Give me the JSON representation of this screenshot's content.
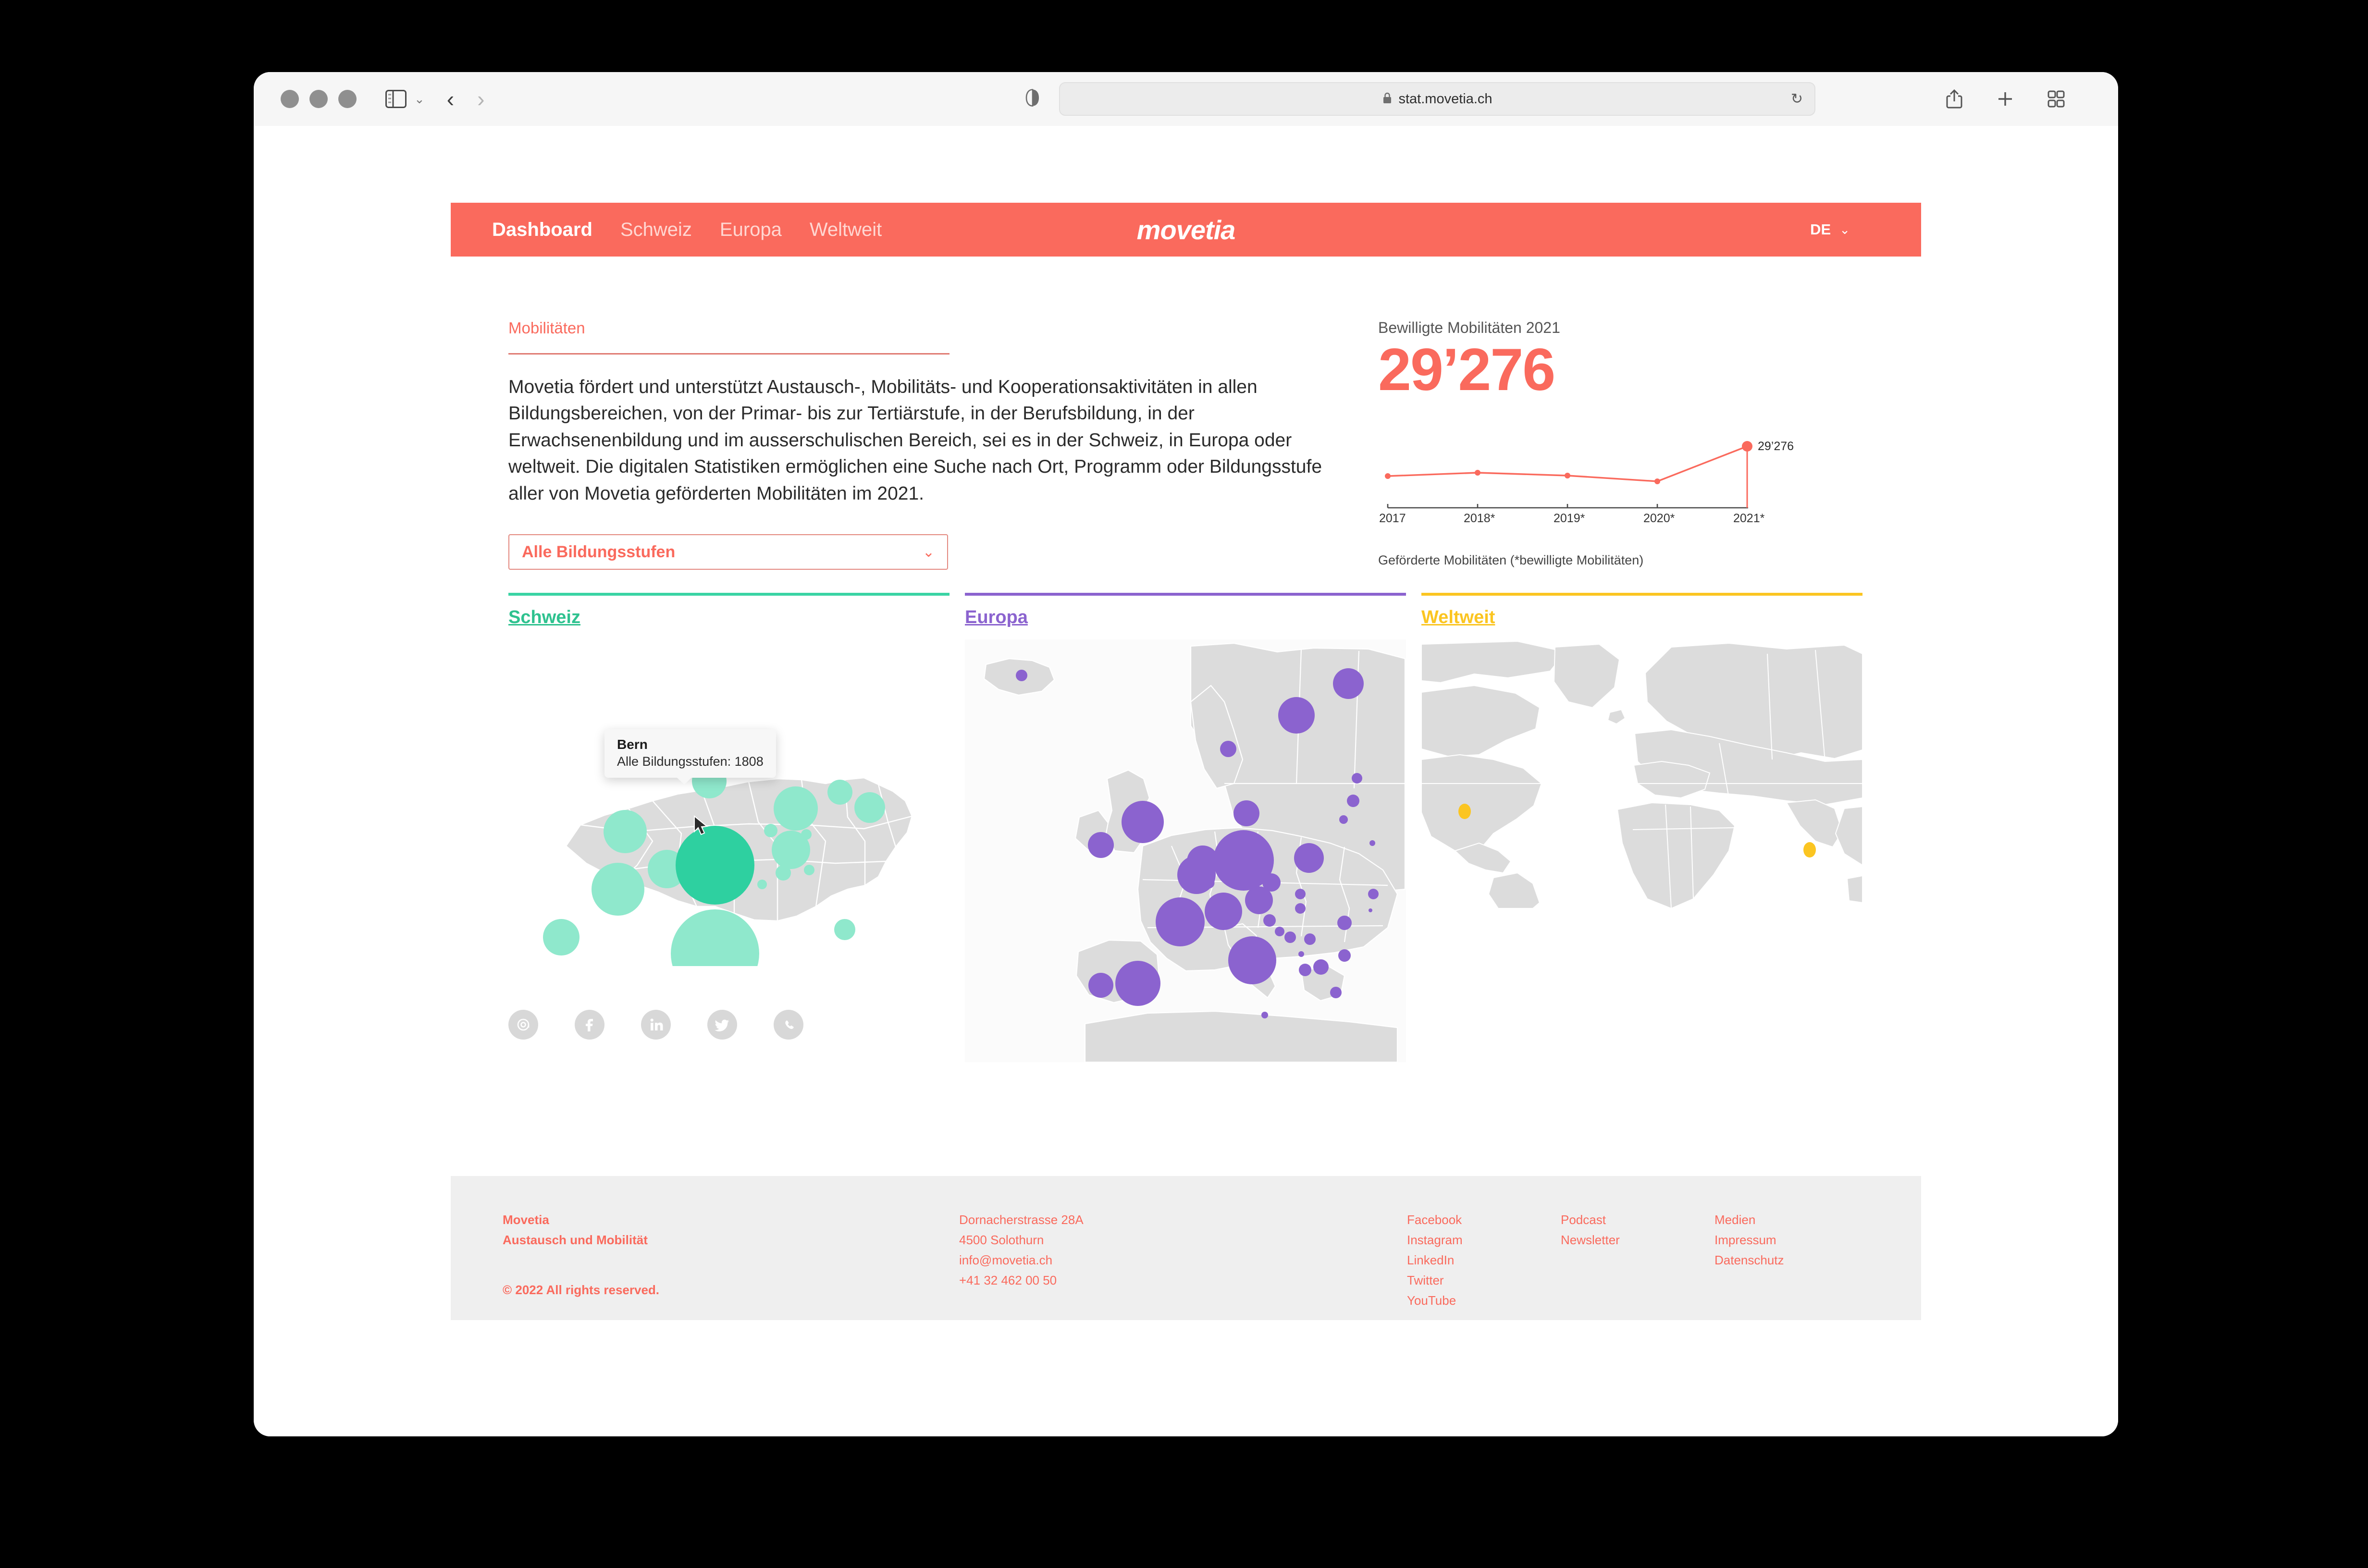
{
  "browser": {
    "url": "stat.movetia.ch",
    "lock_icon": "lock-icon",
    "reload_icon": "reload-icon",
    "back_icon": "chevron-left-icon",
    "forward_icon": "chevron-right-icon",
    "sidebar_icon": "sidebar-toggle-icon",
    "reader_icon": "reader-view-icon",
    "share_icon": "share-icon",
    "newtab_icon": "plus-icon",
    "tabs_icon": "tab-overview-icon"
  },
  "header": {
    "nav": [
      {
        "label": "Dashboard",
        "active": true
      },
      {
        "label": "Schweiz",
        "active": false
      },
      {
        "label": "Europa",
        "active": false
      },
      {
        "label": "Weltweit",
        "active": false
      }
    ],
    "brand": "movetia",
    "language": "DE",
    "chevron": "⌄",
    "bg_color": "#fa6a5d"
  },
  "intro": {
    "title": "Mobilitäten",
    "body": "Movetia fördert und unterstützt Austausch-, Mobilitäts- und Kooperationsaktivitäten in allen Bildungsbereichen, von der Primar- bis zur Tertiärstufe, in der Berufsbildung, in der Erwachsenenbildung und im ausserschulischen Bereich, sei es in der Schweiz, in Europa oder weltweit. Die digitalen Statistiken ermöglichen eine Suche nach Ort, Programm oder Bildungsstufe aller von Movetia geförderten Mobilitäten im 2021."
  },
  "stat": {
    "label": "Bewilligte Mobilitäten 2021",
    "value": "29’276",
    "caption": "Geförderte Mobilitäten (*bewilligte Mobilitäten)",
    "point_label": "29’276",
    "accent": "#fa6a5d"
  },
  "chart_data": {
    "type": "line",
    "title": "Bewilligte Mobilitäten 2021",
    "xlabel": "",
    "ylabel": "",
    "categories": [
      "2017",
      "2018*",
      "2019*",
      "2020*",
      "2021*"
    ],
    "values": [
      20500,
      21600,
      20900,
      19200,
      29276
    ],
    "ylim": [
      0,
      32000
    ],
    "grid": false,
    "legend": "none",
    "annotations": [
      "29’276"
    ],
    "series_color": "#fa6a5d",
    "caption": "Geförderte Mobilitäten (*bewilligte Mobilitäten)"
  },
  "filter": {
    "value": "Alle Bildungsstufen",
    "chevron": "⌄"
  },
  "panels": [
    {
      "key": "schweiz",
      "title": "Schweiz",
      "color": "#2ec28f",
      "rule_color": "#3ad4a4"
    },
    {
      "key": "europa",
      "title": "Europa",
      "color": "#8b63cf",
      "rule_color": "#8b63cf"
    },
    {
      "key": "weltweit",
      "title": "Weltweit",
      "color": "#fbc521",
      "rule_color": "#fbc521"
    }
  ],
  "tooltip": {
    "title": "Bern",
    "detail": "Alle Bildungsstufen: 1808"
  },
  "social": [
    {
      "name": "email-icon",
      "glyph": "@"
    },
    {
      "name": "facebook-icon",
      "glyph": "f"
    },
    {
      "name": "linkedin-icon",
      "glyph": "in"
    },
    {
      "name": "twitter-icon",
      "glyph": "t"
    },
    {
      "name": "whatsapp-icon",
      "glyph": "w"
    }
  ],
  "footer": {
    "brand_line1": "Movetia",
    "brand_line2": "Austausch und Mobilität",
    "copyright": "© 2022 All rights reserved.",
    "address": [
      "Dornacherstrasse 28A",
      "4500 Solothurn",
      "info@movetia.ch",
      "+41 32 462 00 50"
    ],
    "social_links": [
      "Facebook",
      "Instagram",
      "LinkedIn",
      "Twitter",
      "YouTube"
    ],
    "media_links": [
      "Podcast",
      "Newsletter"
    ],
    "legal_links": [
      "Medien",
      "Impressum",
      "Datenschutz"
    ]
  }
}
